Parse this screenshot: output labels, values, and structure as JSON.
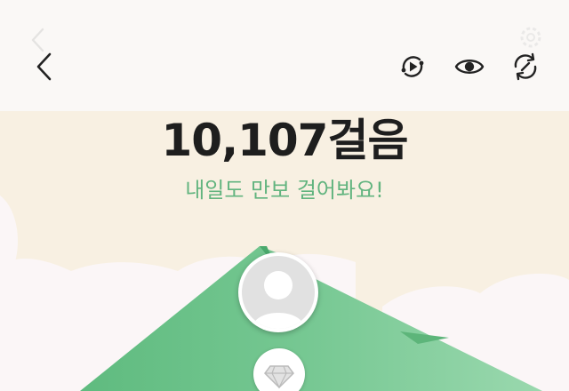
{
  "header": {
    "back_icon": "chevron-left-icon",
    "actions": [
      {
        "name": "replay-icon"
      },
      {
        "name": "eye-icon"
      },
      {
        "name": "refresh-icon"
      }
    ]
  },
  "summary": {
    "steps_text": "10,107걸음",
    "motto": "내일도 만보 걸어봐요!"
  },
  "colors": {
    "background": "#faf8f6",
    "scene_bg": "#f8f0e2",
    "mountain": "#72c38e",
    "motto": "#62b47f"
  },
  "profile": {
    "avatar_icon": "default-avatar-icon",
    "badge_icon": "diamond-icon"
  }
}
